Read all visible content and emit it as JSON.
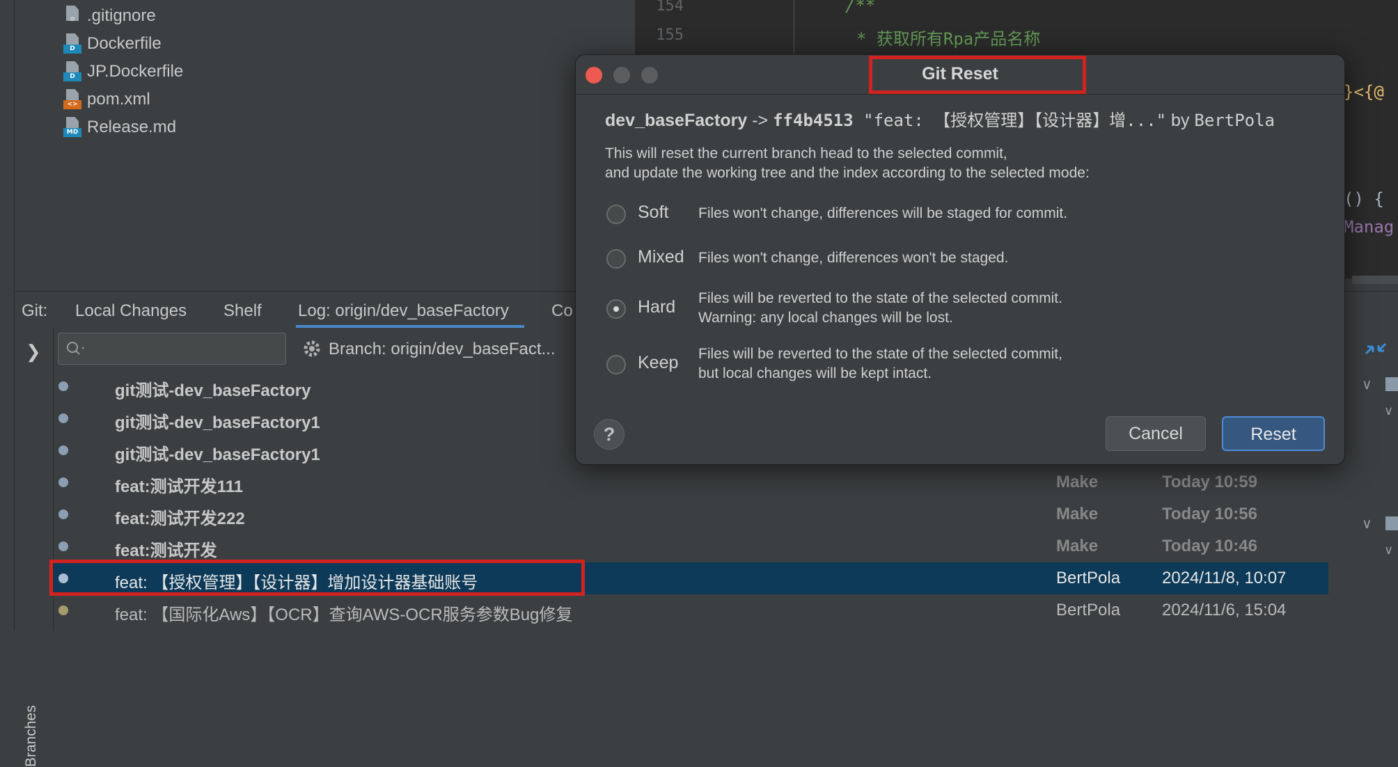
{
  "project_tree": {
    "files": [
      {
        "name": ".gitignore",
        "icon": "gitignore-file-icon",
        "tag": ""
      },
      {
        "name": "Dockerfile",
        "icon": "docker-file-icon",
        "tag": "D"
      },
      {
        "name": "JP.Dockerfile",
        "icon": "docker-file-icon",
        "tag": "D"
      },
      {
        "name": "pom.xml",
        "icon": "xml-file-icon",
        "tag": "<>"
      },
      {
        "name": "Release.md",
        "icon": "markdown-file-icon",
        "tag": "MD"
      }
    ]
  },
  "editor": {
    "line_numbers": [
      "154",
      "155"
    ],
    "code_comment_open": "/**",
    "code_comment_line": "* 获取所有Rpa产品名称",
    "code_fragment_1": "}<{@",
    "code_fragment_2": "() {",
    "code_fragment_3": "Manag"
  },
  "tool_tabs": {
    "prefix": "Git:",
    "items": [
      "Local Changes",
      "Shelf",
      "Log: origin/dev_baseFactory",
      "Co"
    ],
    "active_index": 2
  },
  "log": {
    "branches_label": "Branches",
    "search_placeholder": "",
    "branch_filter": "Branch: origin/dev_baseFact...",
    "commits": [
      {
        "message": "git测试-dev_baseFactory",
        "author": "",
        "date": ""
      },
      {
        "message": "git测试-dev_baseFactory1",
        "author": "",
        "date": ""
      },
      {
        "message": "git测试-dev_baseFactory1",
        "author": "",
        "date": ""
      },
      {
        "message": "feat:测试开发111",
        "author": "Make",
        "date": "Today 10:59"
      },
      {
        "message": "feat:测试开发222",
        "author": "Make",
        "date": "Today 10:56"
      },
      {
        "message": "feat:测试开发",
        "author": "Make",
        "date": "Today 10:46"
      },
      {
        "message": "feat: 【授权管理】【设计器】增加设计器基础账号",
        "author": "BertPola",
        "date": "2024/11/8, 10:07"
      },
      {
        "message": "feat: 【国际化Aws】【OCR】查询AWS-OCR服务参数Bug修复",
        "author": "BertPola",
        "date": "2024/11/6, 15:04"
      }
    ]
  },
  "dialog": {
    "title": "Git Reset",
    "branch": "dev_baseFactory",
    "arrow": " -> ",
    "hash": "ff4b4513",
    "commit_msg": " \"feat: 【授权管理】【设计器】增...\"",
    "by": " by ",
    "author": "BertPola",
    "description_line1": "This will reset the current branch head to the selected commit,",
    "description_line2": "and update the working tree and the index according to the selected mode:",
    "modes": [
      {
        "label": "Soft",
        "desc1": "Files won't change, differences will be staged for commit.",
        "desc2": "",
        "selected": false
      },
      {
        "label": "Mixed",
        "desc1": "Files won't change, differences won't be staged.",
        "desc2": "",
        "selected": false
      },
      {
        "label": "Hard",
        "desc1": "Files will be reverted to the state of the selected commit.",
        "desc2": "Warning: any local changes will be lost.",
        "selected": true
      },
      {
        "label": "Keep",
        "desc1": "Files will be reverted to the state of the selected commit,",
        "desc2": "but local changes will be kept intact.",
        "selected": false
      }
    ],
    "help_label": "?",
    "cancel_label": "Cancel",
    "reset_label": "Reset"
  },
  "colors": {
    "highlight": "#d1231f",
    "selection": "#0d3a58",
    "primary_button": "#365880",
    "close_button": "#ee5a52"
  }
}
